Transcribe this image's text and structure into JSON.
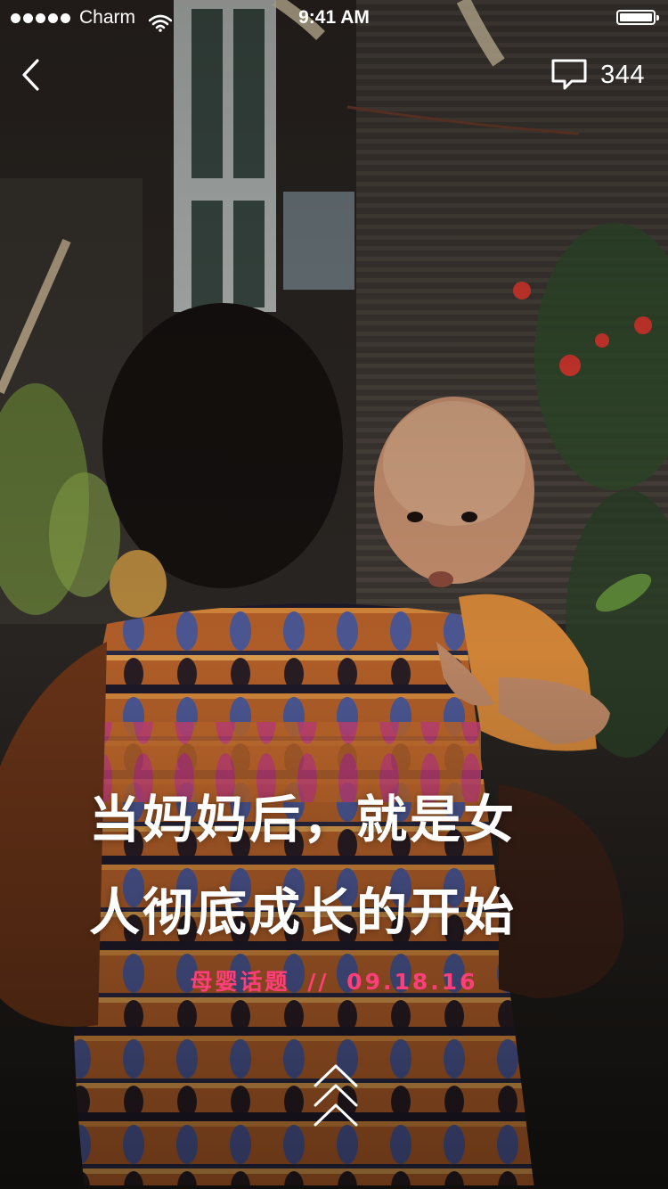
{
  "status_bar": {
    "carrier": "Charm",
    "time": "9:41 AM",
    "signal_bars": 5,
    "battery_level": 1.0
  },
  "nav": {
    "back_icon": "chevron-left-icon",
    "comment_icon": "speech-bubble-icon",
    "comment_count": "344"
  },
  "article": {
    "title_line1": "当妈妈后，就是女",
    "title_line2": "人彻底成长的开始",
    "category": "母婴话题",
    "separator": "//",
    "date": "09.18.16"
  },
  "footer": {
    "swipe_icon": "double-chevron-up-icon"
  },
  "colors": {
    "accent": "#ff3e7a",
    "text": "#ffffff"
  }
}
